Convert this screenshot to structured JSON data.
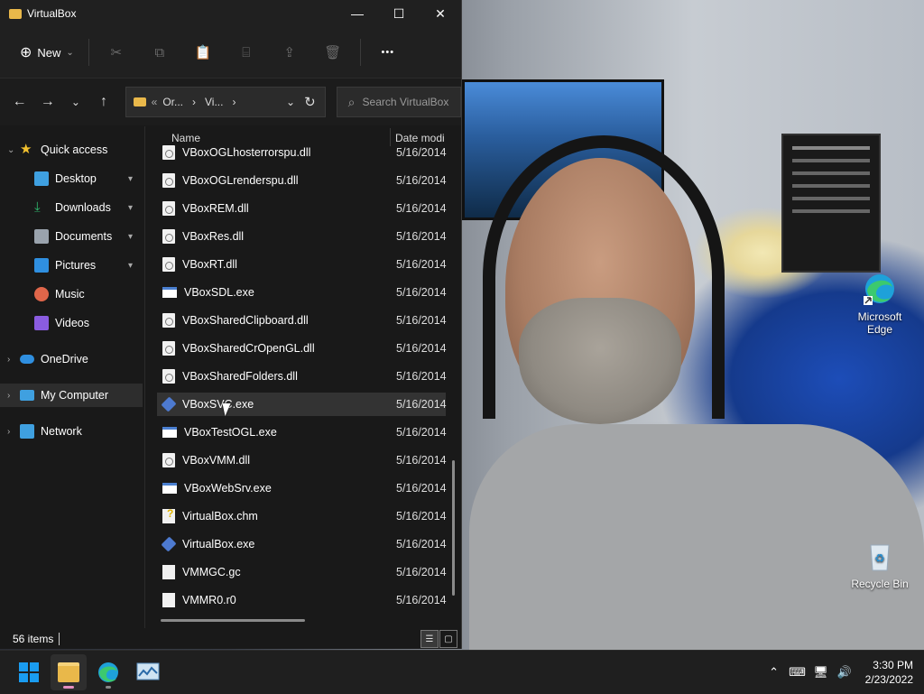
{
  "window": {
    "title": "VirtualBox",
    "controls": {
      "minimize": "—",
      "maximize": "☐",
      "close": "✕"
    }
  },
  "toolbar": {
    "new_label": "New",
    "new_icon": "⊕",
    "new_caret": "⌄",
    "more": "•••",
    "icons": [
      "cut-icon",
      "copy-icon",
      "paste-icon",
      "rename-icon",
      "share-icon",
      "delete-icon"
    ]
  },
  "nav": {
    "back": "←",
    "forward": "→",
    "recent": "⌄",
    "up": "↑",
    "refresh": "↻"
  },
  "address": {
    "prefix": "«",
    "seg1": "Or...",
    "sep": "›",
    "seg2": "Vi...",
    "trail": "›",
    "dropdown": "⌄"
  },
  "search": {
    "placeholder": "Search VirtualBox",
    "icon": "⌕"
  },
  "sidebar": {
    "items": [
      {
        "label": "Quick access",
        "icon_color": "#f2c12e",
        "chev": "⌄"
      },
      {
        "label": "Desktop",
        "icon_color": "#3fa0e0",
        "pin": "📌"
      },
      {
        "label": "Downloads",
        "icon_color": "#2fb56b",
        "pin": "📌"
      },
      {
        "label": "Documents",
        "icon_color": "#9aa3ad",
        "pin": "📌"
      },
      {
        "label": "Pictures",
        "icon_color": "#2f8fe0",
        "pin": "📌"
      },
      {
        "label": "Music",
        "icon_color": "#e0664a"
      },
      {
        "label": "Videos",
        "icon_color": "#8a5ce0"
      },
      {
        "label": "OneDrive",
        "icon_color": "#2f8fe0",
        "chev": "›"
      },
      {
        "label": "My Computer",
        "icon_color": "#3fa0e0",
        "chev": "›"
      },
      {
        "label": "Network",
        "icon_color": "#3fa0e0",
        "chev": "›"
      }
    ]
  },
  "filelist": {
    "columns": {
      "name": "Name",
      "date": "Date modi",
      "sort_caret": "⌃"
    },
    "rows": [
      {
        "name": "VBoxOGLhosterrorspu.dll",
        "date": "5/16/2014",
        "icon": "dll"
      },
      {
        "name": "VBoxOGLrenderspu.dll",
        "date": "5/16/2014",
        "icon": "dll"
      },
      {
        "name": "VBoxREM.dll",
        "date": "5/16/2014",
        "icon": "dll"
      },
      {
        "name": "VBoxRes.dll",
        "date": "5/16/2014",
        "icon": "dll"
      },
      {
        "name": "VBoxRT.dll",
        "date": "5/16/2014",
        "icon": "dll"
      },
      {
        "name": "VBoxSDL.exe",
        "date": "5/16/2014",
        "icon": "exe"
      },
      {
        "name": "VBoxSharedClipboard.dll",
        "date": "5/16/2014",
        "icon": "dll"
      },
      {
        "name": "VBoxSharedCrOpenGL.dll",
        "date": "5/16/2014",
        "icon": "dll"
      },
      {
        "name": "VBoxSharedFolders.dll",
        "date": "5/16/2014",
        "icon": "dll"
      },
      {
        "name": "VBoxSVC.exe",
        "date": "5/16/2014",
        "icon": "vbox"
      },
      {
        "name": "VBoxTestOGL.exe",
        "date": "5/16/2014",
        "icon": "exe"
      },
      {
        "name": "VBoxVMM.dll",
        "date": "5/16/2014",
        "icon": "dll"
      },
      {
        "name": "VBoxWebSrv.exe",
        "date": "5/16/2014",
        "icon": "exe"
      },
      {
        "name": "VirtualBox.chm",
        "date": "5/16/2014",
        "icon": "chm"
      },
      {
        "name": "VirtualBox.exe",
        "date": "5/16/2014",
        "icon": "vbox"
      },
      {
        "name": "VMMGC.gc",
        "date": "5/16/2014",
        "icon": "file"
      },
      {
        "name": "VMMR0.r0",
        "date": "5/16/2014",
        "icon": "file"
      }
    ]
  },
  "status": {
    "item_count": "56 items",
    "view_details": "☰",
    "view_tiles": "▢"
  },
  "desktop_icons": [
    {
      "label_line1": "Microsoft",
      "label_line2": "Edge"
    },
    {
      "label_line1": "Recycle Bin",
      "label_line2": ""
    }
  ],
  "taskbar": {
    "apps": [
      "start-button",
      "file-explorer-taskbar",
      "edge-taskbar",
      "photos-taskbar"
    ],
    "tray": {
      "chevron": "⌃",
      "keyboard": "⌨",
      "network": "🖥",
      "volume": "🔊"
    },
    "clock": {
      "time": "3:30 PM",
      "date": "2/23/2022"
    }
  }
}
